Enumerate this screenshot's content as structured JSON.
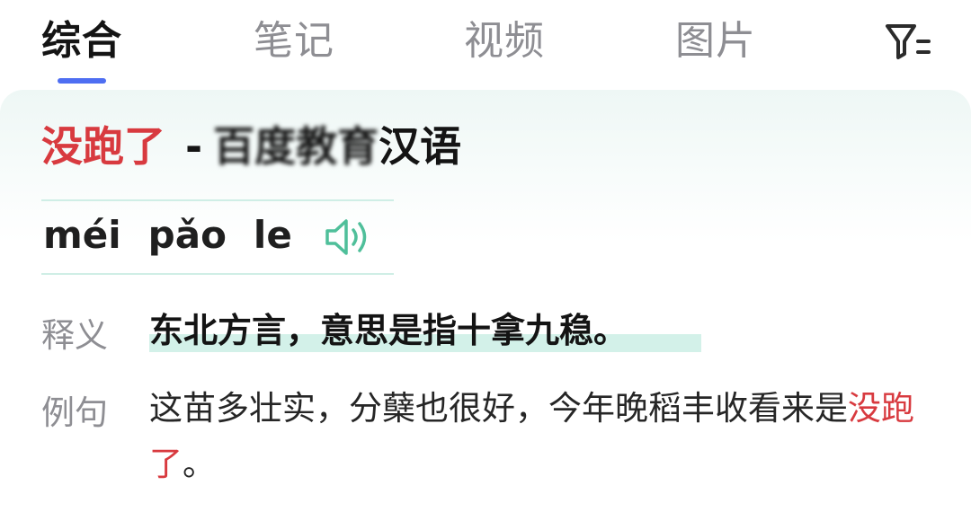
{
  "tabs": {
    "items": [
      {
        "label": "综合",
        "active": true
      },
      {
        "label": "笔记",
        "active": false
      },
      {
        "label": "视频",
        "active": false
      },
      {
        "label": "图片",
        "active": false
      }
    ],
    "filter_icon": "filter-icon"
  },
  "entry": {
    "title_keyword": "没跑了",
    "title_separator": "-",
    "title_source_obscured": "百度教育",
    "title_source_suffix": "汉语",
    "pinyin": [
      "méi",
      "pǎo",
      "le"
    ],
    "speaker_icon": "speaker-icon",
    "definition_label": "释义",
    "definition": "东北方言，意思是指十拿九稳。",
    "example_label": "例句",
    "example_prefix": "这苗多壮实，分蘖也很好，今年晚稻丰收看来是",
    "example_keyword": "没跑了",
    "example_suffix": "。"
  },
  "colors": {
    "accent_blue": "#4e6ef2",
    "keyword_red": "#d83a3f",
    "highlight_green": "#d3f1e9",
    "speaker_green": "#4fbf9a"
  }
}
